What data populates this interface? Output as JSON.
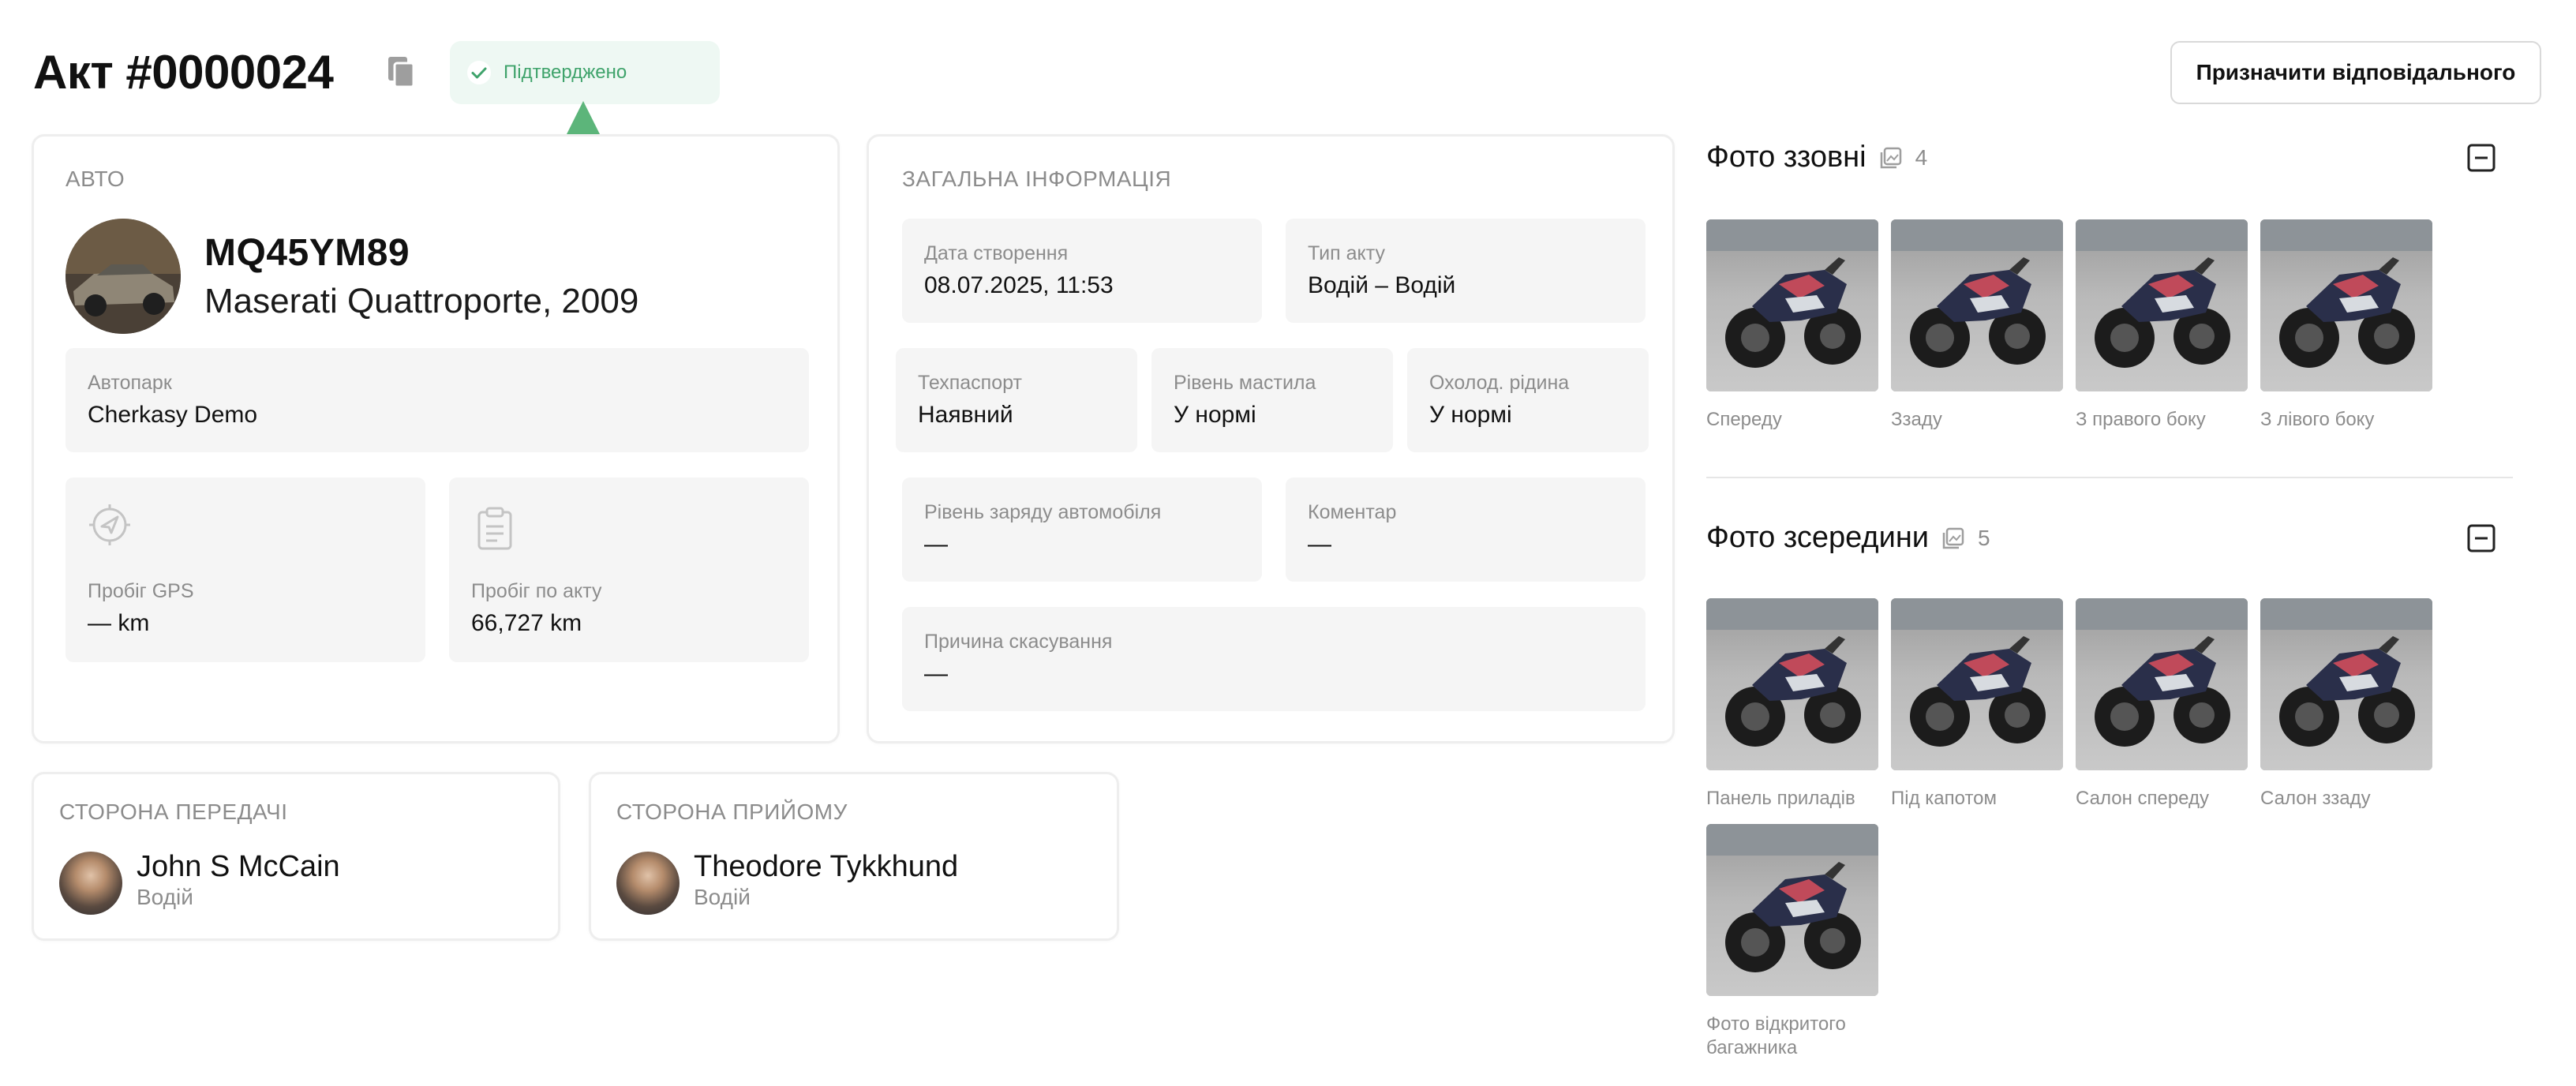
{
  "header": {
    "title": "Акт #0000024",
    "status": "Підтверджено",
    "assign_button": "Призначити відповідального"
  },
  "car": {
    "section_label": "АВТО",
    "plate": "MQ45YM89",
    "model": "Maserati Quattroporte, 2009",
    "fleet_label": "Автопарк",
    "fleet_value": "Cherkasy Demo",
    "gps_label": "Пробіг GPS",
    "gps_value": "— km",
    "act_mileage_label": "Пробіг по акту",
    "act_mileage_value": "66,727 km"
  },
  "general": {
    "section_label": "ЗАГАЛЬНА ІНФОРМАЦІЯ",
    "created_label": "Дата створення",
    "created_value": "08.07.2025, 11:53",
    "type_label": "Тип акту",
    "type_value": "Водій – Водій",
    "passport_label": "Техпаспорт",
    "passport_value": "Наявний",
    "oil_label": "Рівень мастила",
    "oil_value": "У нормі",
    "coolant_label": "Охолод. рідина",
    "coolant_value": "У нормі",
    "charge_label": "Рівень заряду автомобіля",
    "charge_value": "—",
    "comment_label": "Коментар",
    "comment_value": "—",
    "cancel_label": "Причина скасування",
    "cancel_value": "—"
  },
  "sender": {
    "section_label": "СТОРОНА ПЕРЕДАЧІ",
    "name": "John S McCain",
    "role": "Водій"
  },
  "receiver": {
    "section_label": "СТОРОНА ПРИЙОМУ",
    "name": "Theodore Tykkhund",
    "role": "Водій"
  },
  "photos_outside": {
    "title": "Фото ззовні",
    "count": "4",
    "items": [
      "Спереду",
      "Ззаду",
      "З правого боку",
      "З лівого боку"
    ]
  },
  "photos_inside": {
    "title": "Фото зсередини",
    "count": "5",
    "items": [
      "Панель приладів",
      "Під капотом",
      "Салон спереду",
      "Салон ззаду",
      "Фото відкритого багажника"
    ]
  },
  "colors": {
    "status_green": "#3fa36b",
    "status_bg": "#eef8f3",
    "arrow_green": "#5cb57a"
  },
  "icons": {
    "copy": "copy-icon",
    "check": "check-icon",
    "gps": "navigation-icon",
    "act": "clipboard-icon",
    "images": "images-icon",
    "collapse": "minus-square-icon"
  }
}
